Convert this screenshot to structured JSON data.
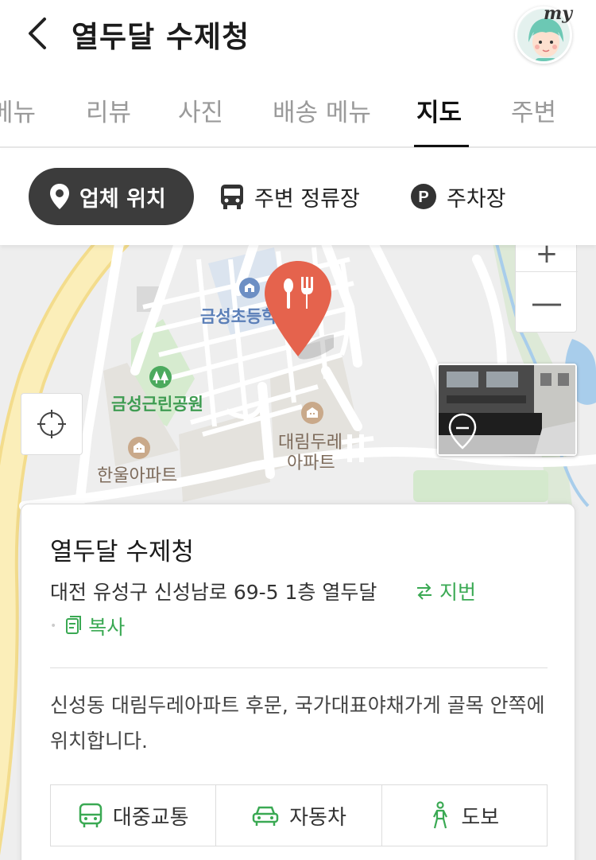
{
  "header": {
    "title": "열두달 수제청",
    "profile_badge": "my"
  },
  "tabs": [
    {
      "label": "메뉴"
    },
    {
      "label": "리뷰"
    },
    {
      "label": "사진"
    },
    {
      "label": "배송 메뉴"
    },
    {
      "label": "지도",
      "active": true
    },
    {
      "label": "주변"
    }
  ],
  "map_chips": [
    {
      "label": "업체 위치",
      "icon": "map-pin-icon",
      "active": true
    },
    {
      "label": "주변 정류장",
      "icon": "bus-icon"
    },
    {
      "label": "주차장",
      "icon": "parking-icon"
    }
  ],
  "map": {
    "labels": {
      "school": "금성초등학교",
      "park": "금성근린공원",
      "apt_daerim_1": "대림두레",
      "apt_daerim_2": "아파트",
      "apt_hanul": "한울아파트"
    },
    "zoom_out_symbol": "—",
    "marker_icon": "restaurant-icon"
  },
  "card": {
    "title": "열두달 수제청",
    "address": "대전 유성구 신성남로 69-5 1층 열두달",
    "jibun_label": "지번",
    "copy_label": "복사",
    "description": "신성동 대림두레아파트 후문, 국가대표야채가게 골목 안쪽에 위치합니다.",
    "transit": [
      {
        "label": "대중교통",
        "icon": "bus-icon"
      },
      {
        "label": "자동차",
        "icon": "car-icon"
      },
      {
        "label": "도보",
        "icon": "walking-icon"
      }
    ]
  },
  "colors": {
    "accent_green": "#3aa953",
    "marker_red": "#e5634d",
    "chip_dark": "#3c3c3c"
  }
}
